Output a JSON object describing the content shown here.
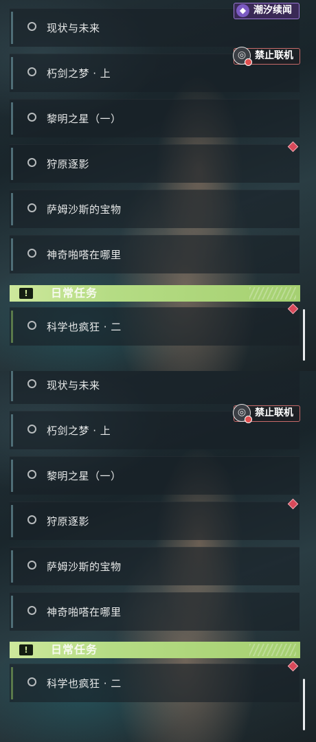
{
  "quests": [
    {
      "label": "现状与未来"
    },
    {
      "label": "朽剑之梦 · 上"
    },
    {
      "label": "黎明之星（一）"
    },
    {
      "label": "狩原逐影"
    },
    {
      "label": "萨姆沙斯的宝物"
    },
    {
      "label": "神奇啪嗒在哪里"
    }
  ],
  "daily_section": {
    "badge": "!",
    "title": "日常任务",
    "quest": {
      "label": "科学也疯狂 · 二"
    }
  },
  "tags": {
    "tide": "潮汐续闻",
    "no_online": "禁止联机"
  },
  "icons": {
    "quest_status": "circle-outline-icon",
    "tide": "tide-logo-icon",
    "no_online": "globe-blocked-icon",
    "marker": "red-diamond-icon"
  },
  "colors": {
    "daily_accent": "#b5dc84",
    "no_online_border": "#c86a6a",
    "tide_border": "#9b7ad6",
    "marker": "#d8495a"
  }
}
